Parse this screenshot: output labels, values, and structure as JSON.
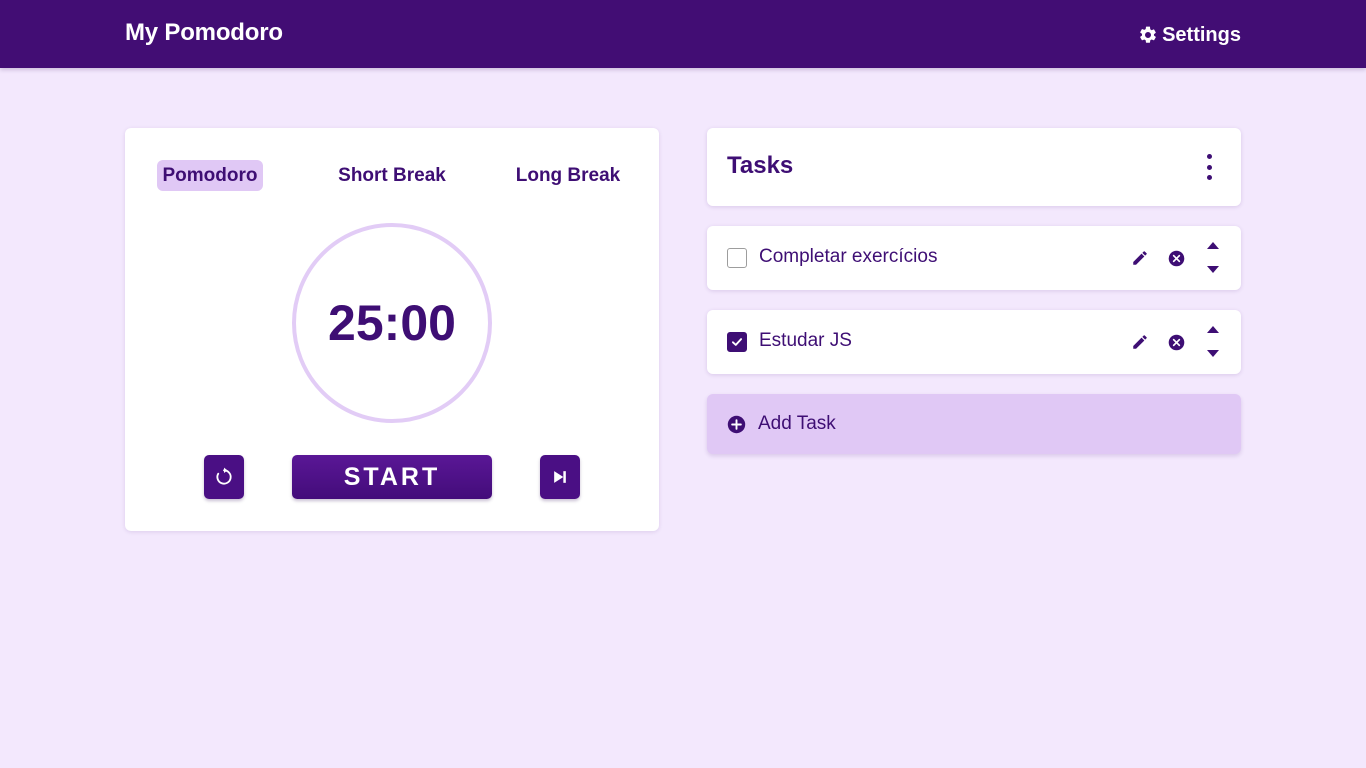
{
  "header": {
    "app_title": "My Pomodoro",
    "settings_label": "Settings",
    "settings_icon": "gear-icon"
  },
  "timer": {
    "modes": [
      {
        "label": "Pomodoro",
        "active": true
      },
      {
        "label": "Short Break",
        "active": false
      },
      {
        "label": "Long Break",
        "active": false
      }
    ],
    "display": "25:00",
    "start_label": "START",
    "reset_icon": "reset-icon",
    "skip_icon": "skip-icon"
  },
  "tasks": {
    "title": "Tasks",
    "menu_icon": "kebab-menu-icon",
    "items": [
      {
        "label": "Completar exercícios",
        "checked": false
      },
      {
        "label": "Estudar JS",
        "checked": true
      }
    ],
    "add_label": "Add Task",
    "add_icon": "plus-circle-icon"
  },
  "colors": {
    "primary": "#420d74",
    "background": "#f3e8fd",
    "accent_light": "#e0c8f5",
    "text": "#3e0e74"
  }
}
